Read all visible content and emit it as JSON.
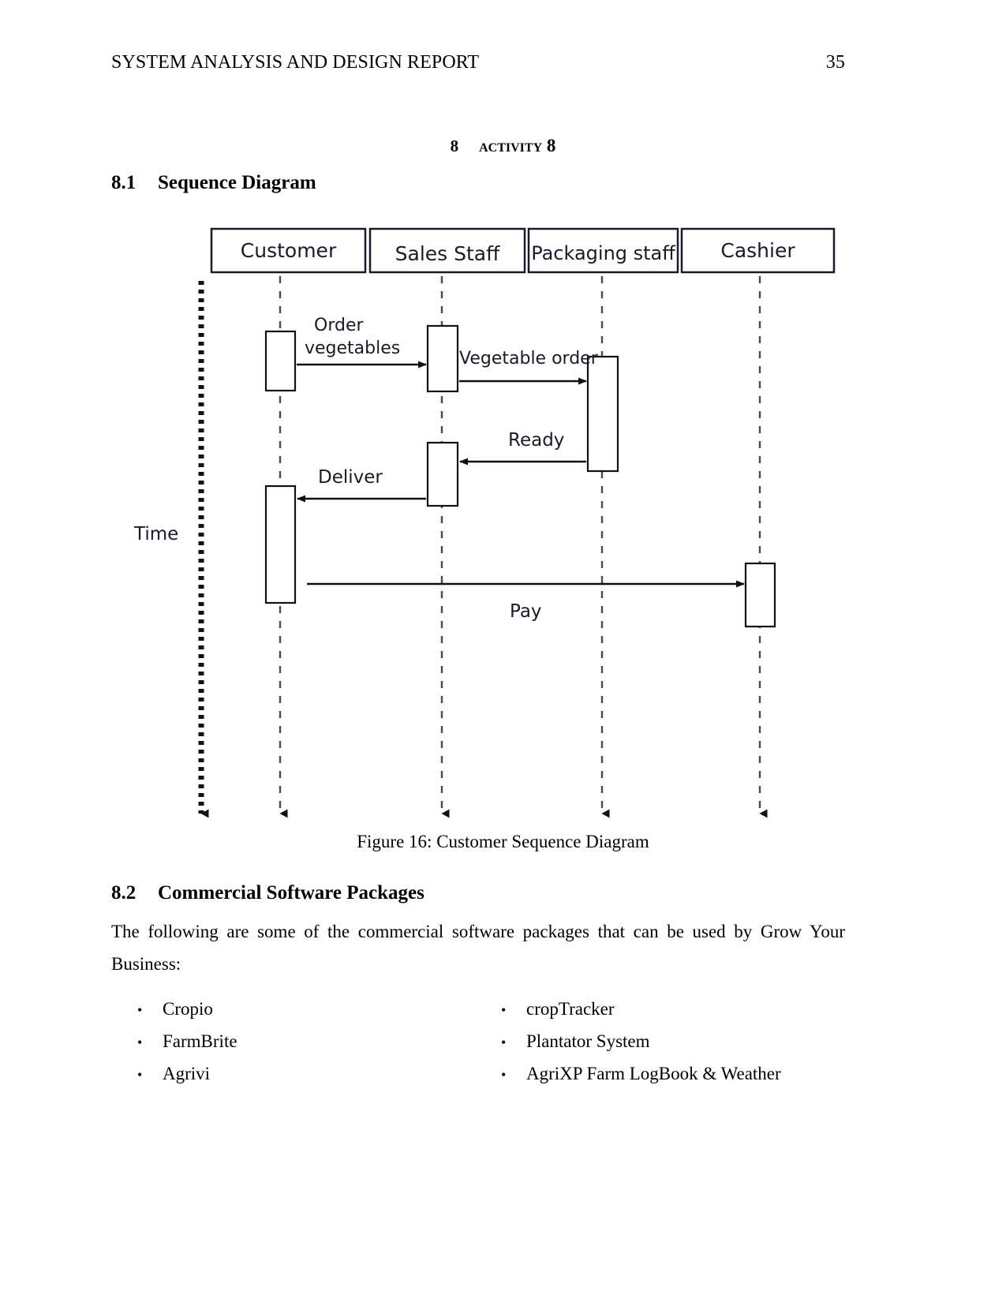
{
  "header": {
    "title": "SYSTEM ANALYSIS AND DESIGN REPORT",
    "page_number": "35"
  },
  "chapter": {
    "number": "8",
    "name": "Activity 8"
  },
  "sections": {
    "sequence_diagram": {
      "number": "8.1",
      "title": "Sequence Diagram"
    },
    "commercial_software": {
      "number": "8.2",
      "title": "Commercial Software Packages"
    }
  },
  "figure": {
    "caption": "Figure 16: Customer Sequence Diagram",
    "axis_label": "Time",
    "lifelines": [
      {
        "id": "customer",
        "label": "Customer"
      },
      {
        "id": "sales-staff",
        "label": "Sales Staff"
      },
      {
        "id": "packaging-staff",
        "label": "Packaging staff"
      },
      {
        "id": "cashier",
        "label": "Cashier"
      }
    ],
    "messages": [
      {
        "id": "order-vegetables",
        "label_line1": "Order",
        "label_line2": "vegetables",
        "from": "customer",
        "to": "sales-staff",
        "direction": "right"
      },
      {
        "id": "vegetable-order",
        "label_line1": "Vegetable order",
        "label_line2": "",
        "from": "sales-staff",
        "to": "packaging-staff",
        "direction": "right"
      },
      {
        "id": "ready",
        "label_line1": "Ready",
        "label_line2": "",
        "from": "packaging-staff",
        "to": "sales-staff",
        "direction": "left"
      },
      {
        "id": "deliver",
        "label_line1": "Deliver",
        "label_line2": "",
        "from": "sales-staff",
        "to": "customer",
        "direction": "left"
      },
      {
        "id": "pay",
        "label_line1": "Pay",
        "label_line2": "",
        "from": "customer",
        "to": "cashier",
        "direction": "right"
      }
    ]
  },
  "body": {
    "intro_paragraph": "The following are some of the commercial software packages that can be used by Grow Your Business:"
  },
  "software_packages": {
    "bullet_glyph": "•",
    "left_column": [
      "Cropio",
      "FarmBrite",
      "Agrivi"
    ],
    "right_column": [
      "cropTracker",
      "Plantator System",
      "AgriXP Farm LogBook & Weather"
    ]
  }
}
